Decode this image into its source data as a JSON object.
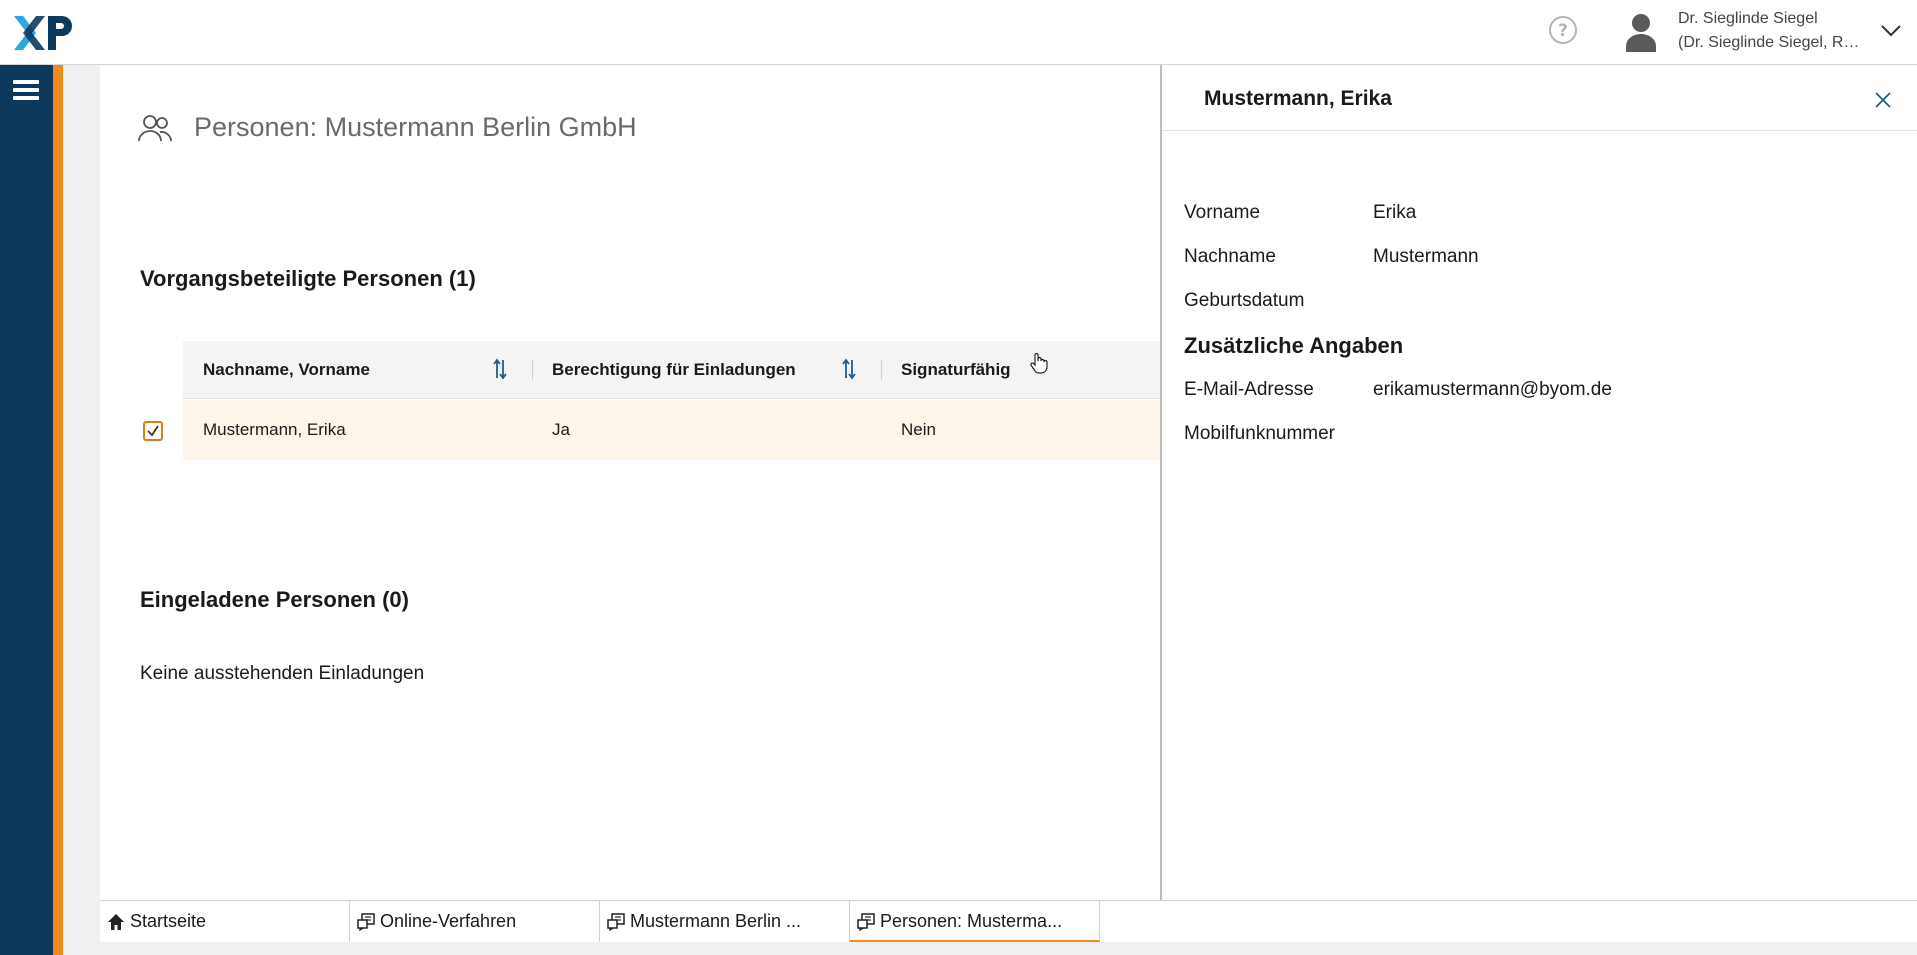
{
  "header": {
    "logo_text": "XP",
    "user_name": "Dr. Sieglinde Siegel",
    "user_org": "(Dr. Sieglinde Siegel, Rec..."
  },
  "page": {
    "title": "Personen: Mustermann Berlin GmbH"
  },
  "participants": {
    "title": "Vorgangsbeteiligte Personen (1)",
    "columns": [
      "Nachname, Vorname",
      "Berechtigung für Einladungen",
      "Signaturfähig"
    ],
    "rows": [
      {
        "name": "Mustermann, Erika",
        "invite_permission": "Ja",
        "signature": "Nein",
        "selected": true
      }
    ]
  },
  "invited": {
    "title": "Eingeladene Personen (0)",
    "empty_text": "Keine ausstehenden Einladungen"
  },
  "detail": {
    "title": "Mustermann, Erika",
    "fields": [
      {
        "label": "Vorname",
        "value": "Erika"
      },
      {
        "label": "Nachname",
        "value": "Mustermann"
      },
      {
        "label": "Geburtsdatum",
        "value": ""
      }
    ],
    "extra_title": "Zusätzliche Angaben",
    "extra_fields": [
      {
        "label": "E-Mail-Adresse",
        "value": "erikamustermann@byom.de"
      },
      {
        "label": "Mobilfunknummer",
        "value": ""
      }
    ]
  },
  "tabs": [
    {
      "label": "Startseite",
      "icon": "home-icon",
      "active": false
    },
    {
      "label": "Online-Verfahren",
      "icon": "document-chat-icon",
      "active": false
    },
    {
      "label": "Mustermann Berlin ...",
      "icon": "document-chat-icon",
      "active": false
    },
    {
      "label": "Personen: Musterma...",
      "icon": "document-chat-icon",
      "active": true
    }
  ],
  "colors": {
    "sidebar": "#0d3a5c",
    "accent": "#f08a1c",
    "row_highlight": "#fdf5ea",
    "logo_light_blue": "#2aa8e0",
    "logo_dark": "#0d3a5c"
  }
}
